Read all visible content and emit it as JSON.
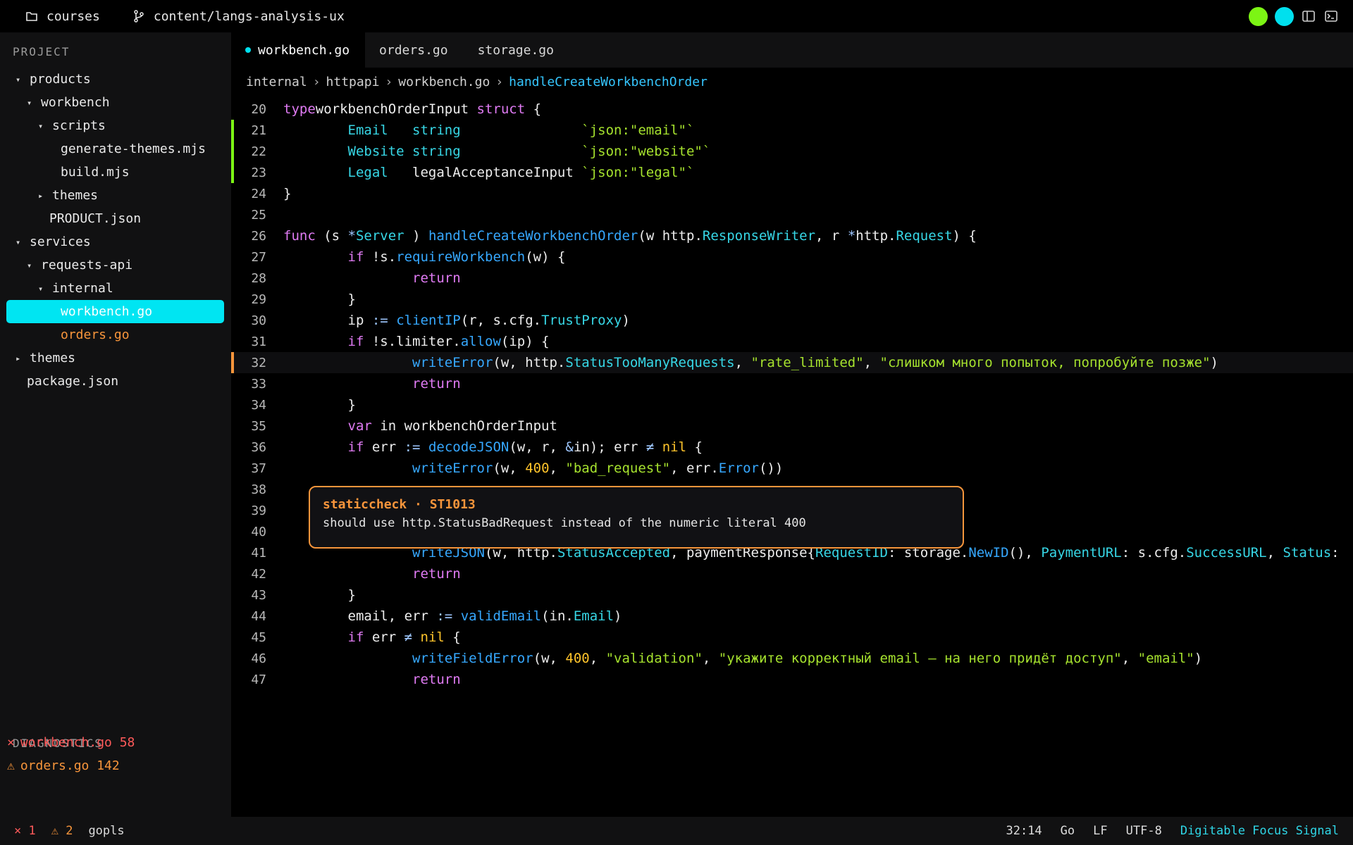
{
  "titlebar": {
    "project": "courses",
    "branch": "content/langs-analysis-ux",
    "dot_colors": [
      "#7cf514",
      "#00e0ee"
    ]
  },
  "sidebar": {
    "project_heading": "PROJECT",
    "tree": [
      {
        "label": "products",
        "depth": 0,
        "arrow": "▾"
      },
      {
        "label": "workbench",
        "depth": 1,
        "arrow": "▾"
      },
      {
        "label": "scripts",
        "depth": 2,
        "arrow": "▾"
      },
      {
        "label": "generate-themes.mjs",
        "depth": 3,
        "arrow": ""
      },
      {
        "label": "build.mjs",
        "depth": 3,
        "arrow": ""
      },
      {
        "label": "themes",
        "depth": 2,
        "arrow": "▸"
      },
      {
        "label": "PRODUCT.json",
        "depth": 2,
        "arrow": ""
      },
      {
        "label": "services",
        "depth": 0,
        "arrow": "▾"
      },
      {
        "label": "requests-api",
        "depth": 1,
        "arrow": "▾"
      },
      {
        "label": "internal",
        "depth": 2,
        "arrow": "▾"
      },
      {
        "label": "workbench.go",
        "depth": 3,
        "arrow": "",
        "state": "selected"
      },
      {
        "label": "orders.go",
        "depth": 3,
        "arrow": "",
        "state": "modified"
      },
      {
        "label": "themes",
        "depth": 0,
        "arrow": "▸"
      },
      {
        "label": "package.json",
        "depth": 0,
        "arrow": ""
      }
    ],
    "diagnostics_heading": "DIAGNOSTICS",
    "diagnostics": [
      {
        "icon": "×",
        "text": "workbench.go 58",
        "kind": "err"
      },
      {
        "icon": "⚠",
        "text": "orders.go 142",
        "kind": "warn"
      }
    ]
  },
  "tabs": [
    {
      "label": "workbench.go",
      "active": true,
      "modified": true
    },
    {
      "label": "orders.go",
      "active": false,
      "modified": false
    },
    {
      "label": "storage.go",
      "active": false,
      "modified": false
    }
  ],
  "breadcrumb": {
    "items": [
      "internal",
      "httpapi",
      "workbench.go"
    ],
    "current": "handleCreateWorkbenchOrder",
    "sep": "›"
  },
  "editor": {
    "lines": [
      {
        "n": "20",
        "segs": [
          [
            "k",
            "type"
          ],
          [
            "",
            "workbenchOrderInput "
          ],
          [
            "k",
            "struct"
          ],
          [
            "",
            " {"
          ]
        ]
      },
      {
        "n": "21",
        "mark": "#7cf514",
        "segs": [
          [
            "",
            "        "
          ],
          [
            "t",
            "Email"
          ],
          [
            "",
            "   "
          ],
          [
            "t",
            "string"
          ],
          [
            "",
            "               "
          ],
          [
            "s",
            "`json:\"email\"`"
          ]
        ]
      },
      {
        "n": "22",
        "mark": "#7cf514",
        "segs": [
          [
            "",
            "        "
          ],
          [
            "t",
            "Website"
          ],
          [
            "",
            " "
          ],
          [
            "t",
            "string"
          ],
          [
            "",
            "               "
          ],
          [
            "s",
            "`json:\"website\"`"
          ]
        ]
      },
      {
        "n": "23",
        "mark": "#7cf514",
        "segs": [
          [
            "",
            "        "
          ],
          [
            "t",
            "Legal"
          ],
          [
            "",
            "   legalAcceptanceInput "
          ],
          [
            "s",
            "`json:\"legal\"`"
          ]
        ]
      },
      {
        "n": "24",
        "segs": [
          [
            "",
            "}"
          ]
        ]
      },
      {
        "n": "25",
        "segs": [
          [
            "",
            ""
          ]
        ]
      },
      {
        "n": "26",
        "segs": [
          [
            "k",
            "func"
          ],
          [
            "",
            " (s "
          ],
          [
            "o",
            "*"
          ],
          [
            "t",
            "Server"
          ],
          [
            "",
            " ) "
          ],
          [
            "f",
            "handleCreateWorkbenchOrder"
          ],
          [
            "",
            "(w http."
          ],
          [
            "t",
            "ResponseWriter"
          ],
          [
            "",
            ", r "
          ],
          [
            "o",
            "*"
          ],
          [
            "",
            "http."
          ],
          [
            "t",
            "Request"
          ],
          [
            "",
            ") {"
          ]
        ]
      },
      {
        "n": "27",
        "segs": [
          [
            "",
            "        "
          ],
          [
            "k",
            "if"
          ],
          [
            "",
            " !s."
          ],
          [
            "f",
            "requireWorkbench"
          ],
          [
            "",
            "(w) {"
          ]
        ]
      },
      {
        "n": "28",
        "segs": [
          [
            "",
            "                "
          ],
          [
            "k",
            "return"
          ]
        ]
      },
      {
        "n": "29",
        "segs": [
          [
            "",
            "        }"
          ]
        ]
      },
      {
        "n": "30",
        "segs": [
          [
            "",
            "        ip "
          ],
          [
            "o",
            ":="
          ],
          [
            "",
            " "
          ],
          [
            "f",
            "clientIP"
          ],
          [
            "",
            "(r, s.cfg."
          ],
          [
            "t",
            "TrustProxy"
          ],
          [
            "",
            ")"
          ]
        ]
      },
      {
        "n": "31",
        "segs": [
          [
            "",
            "        "
          ],
          [
            "k",
            "if"
          ],
          [
            "",
            " !s.limiter."
          ],
          [
            "f",
            "allow"
          ],
          [
            "",
            "(ip) {"
          ]
        ]
      },
      {
        "n": "32",
        "mark": "#f7953b",
        "hl": true,
        "segs": [
          [
            "",
            "                "
          ],
          [
            "f",
            "writeError"
          ],
          [
            "",
            "(w, http."
          ],
          [
            "t",
            "StatusTooManyRequests"
          ],
          [
            "",
            ", "
          ],
          [
            "s",
            "\"rate_limited\""
          ],
          [
            "",
            ", "
          ],
          [
            "s",
            "\"слишком много попыток, попробуйте позже\""
          ],
          [
            "",
            ")"
          ]
        ]
      },
      {
        "n": "33",
        "segs": [
          [
            "",
            "                "
          ],
          [
            "k",
            "return"
          ]
        ]
      },
      {
        "n": "34",
        "segs": [
          [
            "",
            "        }"
          ]
        ]
      },
      {
        "n": "35",
        "segs": [
          [
            "",
            "        "
          ],
          [
            "k",
            "var"
          ],
          [
            "",
            " in workbenchOrderInput"
          ]
        ]
      },
      {
        "n": "36",
        "segs": [
          [
            "",
            "        "
          ],
          [
            "k",
            "if"
          ],
          [
            "",
            " err "
          ],
          [
            "o",
            ":="
          ],
          [
            "",
            " "
          ],
          [
            "f",
            "decodeJSON"
          ],
          [
            "",
            "(w, r, "
          ],
          [
            "o",
            "&"
          ],
          [
            "",
            "in); err "
          ],
          [
            "o",
            "≠"
          ],
          [
            "",
            " "
          ],
          [
            "n",
            "nil"
          ],
          [
            "",
            " {"
          ]
        ]
      },
      {
        "n": "37",
        "segs": [
          [
            "",
            "                "
          ],
          [
            "f",
            "writeError"
          ],
          [
            "",
            "(w, "
          ],
          [
            "n",
            "400"
          ],
          [
            "",
            ", "
          ],
          [
            "s",
            "\"bad_request\""
          ],
          [
            "",
            ", err."
          ],
          [
            "f",
            "Error"
          ],
          [
            "",
            "())"
          ]
        ]
      },
      {
        "n": "38",
        "segs": [
          [
            "",
            ""
          ]
        ]
      },
      {
        "n": "39",
        "segs": [
          [
            "",
            ""
          ]
        ]
      },
      {
        "n": "40",
        "segs": [
          [
            "",
            ""
          ]
        ]
      },
      {
        "n": "41",
        "segs": [
          [
            "",
            "                "
          ],
          [
            "f",
            "writeJSON"
          ],
          [
            "",
            "(w, http."
          ],
          [
            "t",
            "StatusAccepted"
          ],
          [
            "",
            ", paymentResponse{"
          ],
          [
            "t",
            "RequestID"
          ],
          [
            "",
            ": storage."
          ],
          [
            "f",
            "NewID"
          ],
          [
            "",
            "(), "
          ],
          [
            "t",
            "PaymentURL"
          ],
          [
            "",
            ": s.cfg."
          ],
          [
            "t",
            "SuccessURL"
          ],
          [
            "",
            ", "
          ],
          [
            "t",
            "Status"
          ],
          [
            "",
            ":"
          ]
        ]
      },
      {
        "n": "42",
        "segs": [
          [
            "",
            "                "
          ],
          [
            "k",
            "return"
          ]
        ]
      },
      {
        "n": "43",
        "segs": [
          [
            "",
            "        }"
          ]
        ]
      },
      {
        "n": "44",
        "segs": [
          [
            "",
            "        email, err "
          ],
          [
            "o",
            ":="
          ],
          [
            "",
            " "
          ],
          [
            "f",
            "validEmail"
          ],
          [
            "",
            "(in."
          ],
          [
            "t",
            "Email"
          ],
          [
            "",
            ")"
          ]
        ]
      },
      {
        "n": "45",
        "segs": [
          [
            "",
            "        "
          ],
          [
            "k",
            "if"
          ],
          [
            "",
            " err "
          ],
          [
            "o",
            "≠"
          ],
          [
            "",
            " "
          ],
          [
            "n",
            "nil"
          ],
          [
            "",
            " {"
          ]
        ]
      },
      {
        "n": "46",
        "segs": [
          [
            "",
            "                "
          ],
          [
            "f",
            "writeFieldError"
          ],
          [
            "",
            "(w, "
          ],
          [
            "n",
            "400"
          ],
          [
            "",
            ", "
          ],
          [
            "s",
            "\"validation\""
          ],
          [
            "",
            ", "
          ],
          [
            "s",
            "\"укажите корректный email — на него придёт доступ\""
          ],
          [
            "",
            ", "
          ],
          [
            "s",
            "\"email\""
          ],
          [
            "",
            ")"
          ]
        ]
      },
      {
        "n": "47",
        "segs": [
          [
            "",
            "                "
          ],
          [
            "k",
            "return"
          ]
        ]
      }
    ]
  },
  "tooltip": {
    "title": "staticcheck · ST1013",
    "message": "should use http.StatusBadRequest instead of the numeric literal 400"
  },
  "statusbar": {
    "errors": "× 1",
    "warnings": "⚠ 2",
    "lsp": "gopls",
    "position": "32:14",
    "language": "Go",
    "eol": "LF",
    "encoding": "UTF-8",
    "theme": "Digitable Focus Signal"
  }
}
